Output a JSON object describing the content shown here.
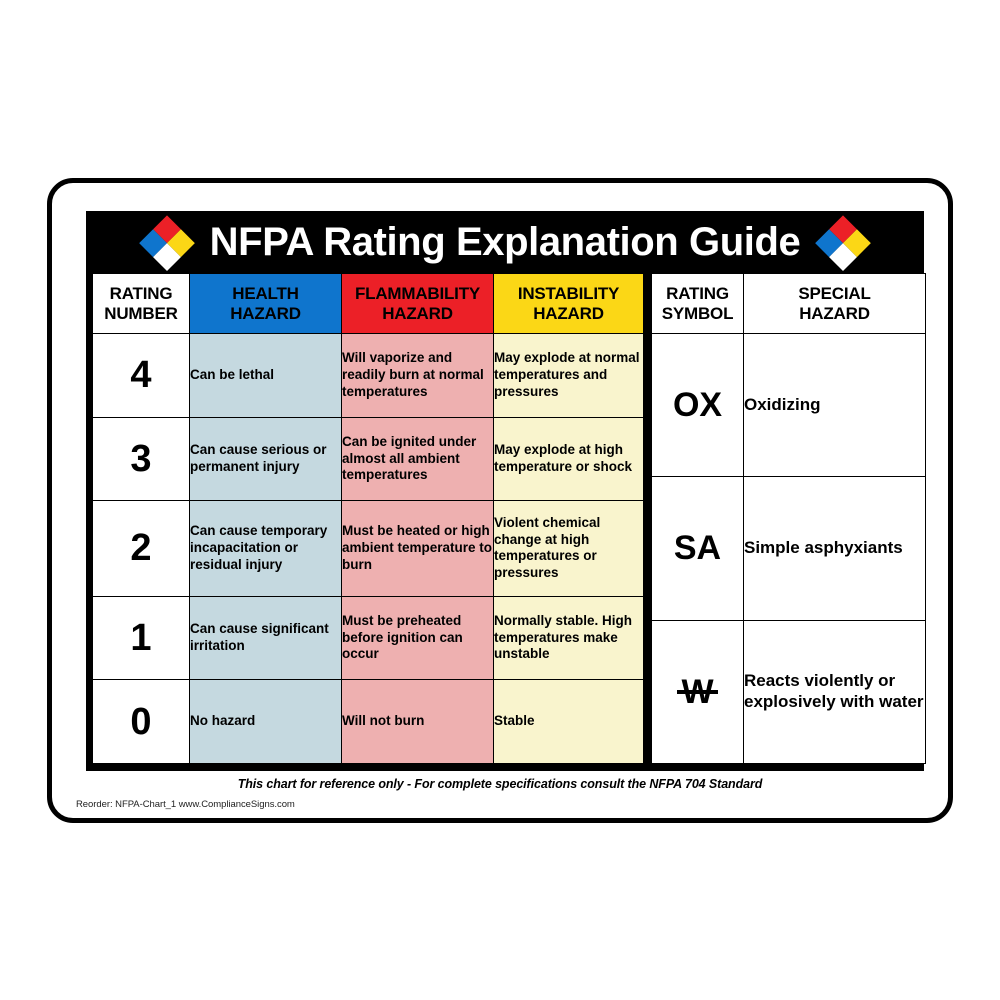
{
  "sign": {
    "title": "NFPA Rating Explanation Guide",
    "diamond_icon_left": "nfpa-diamond-icon",
    "diamond_icon_right": "nfpa-diamond-icon",
    "diamond_colors": {
      "top": "#ec2027",
      "left": "#0f75cd",
      "right": "#fbd716",
      "bottom": "#ffffff"
    },
    "footer_note": "This chart for reference only - For complete specifications consult the NFPA 704 Standard",
    "reorder_line": "Reorder: NFPA-Chart_1 www.ComplianceSigns.com"
  },
  "rating_table": {
    "headers": [
      {
        "label": "RATING\nNUMBER",
        "line1": "RATING",
        "line2": "NUMBER",
        "bg": "#ffffff"
      },
      {
        "label": "HEALTH\nHAZARD",
        "line1": "HEALTH",
        "line2": "HAZARD",
        "bg": "#0f75cd"
      },
      {
        "label": "FLAMMABILITY\nHAZARD",
        "line1": "FLAMMABILITY",
        "line2": "HAZARD",
        "bg": "#ec2027"
      },
      {
        "label": "INSTABILITY\nHAZARD",
        "line1": "INSTABILITY",
        "line2": "HAZARD",
        "bg": "#fbd716"
      }
    ],
    "cell_colors": {
      "health": "#c5d9e0",
      "flammability": "#eeb0b0",
      "instability": "#f9f4cd"
    },
    "rows": [
      {
        "number": "4",
        "health": "Can be lethal",
        "flammability": "Will vaporize and readily burn at normal temperatures",
        "instability": "May explode at normal temperatures and pressures"
      },
      {
        "number": "3",
        "health": "Can cause serious or permanent injury",
        "flammability": "Can be ignited under almost all ambient temperatures",
        "instability": "May explode at high temperature or shock"
      },
      {
        "number": "2",
        "health": "Can cause temporary incapacitation or residual injury",
        "flammability": "Must be heated or high ambient temperature to burn",
        "instability": "Violent chemical change at high temperatures or pressures"
      },
      {
        "number": "1",
        "health": "Can cause significant irritation",
        "flammability": "Must be preheated before ignition can occur",
        "instability": "Normally stable. High temperatures make unstable"
      },
      {
        "number": "0",
        "health": "No hazard",
        "flammability": "Will not burn",
        "instability": "Stable"
      }
    ]
  },
  "special_table": {
    "headers": [
      {
        "line1": "RATING",
        "line2": "SYMBOL"
      },
      {
        "line1": "SPECIAL",
        "line2": "HAZARD"
      }
    ],
    "rows": [
      {
        "symbol": "OX",
        "symbol_name": "ox-symbol",
        "hazard": "Oxidizing"
      },
      {
        "symbol": "SA",
        "symbol_name": "sa-symbol",
        "hazard": "Simple asphyxiants"
      },
      {
        "symbol": "W",
        "symbol_name": "w-strikethrough-symbol",
        "hazard": "Reacts violently or explosively with water"
      }
    ]
  }
}
